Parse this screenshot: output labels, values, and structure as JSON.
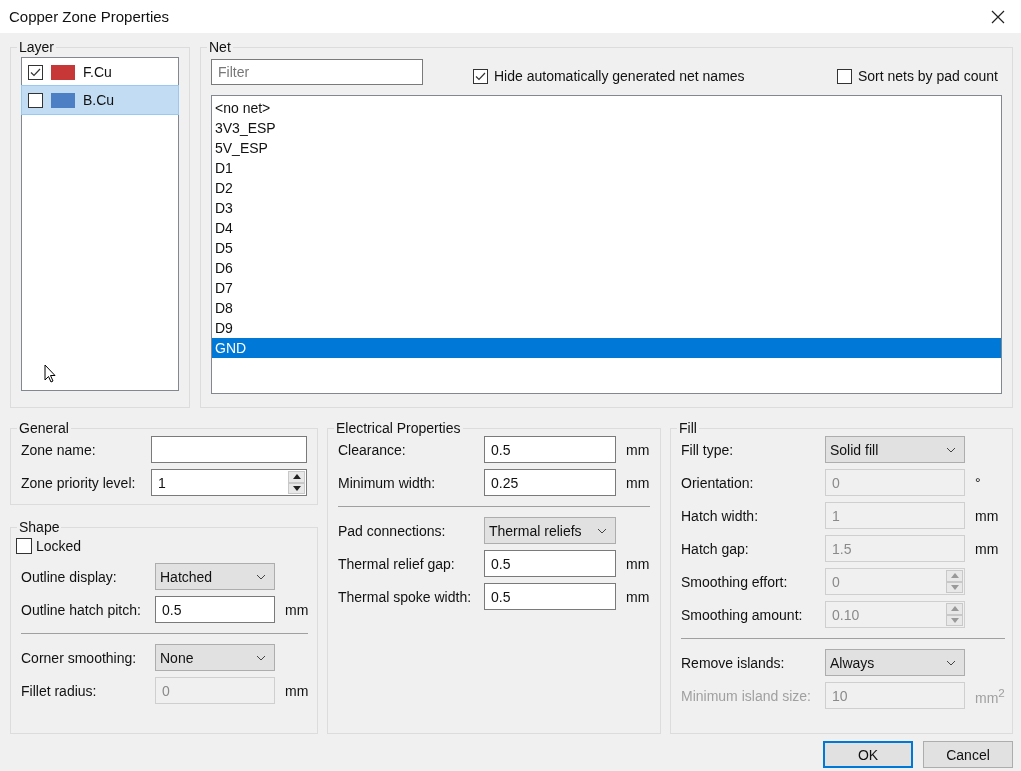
{
  "window": {
    "title": "Copper Zone Properties"
  },
  "layer": {
    "title": "Layer",
    "items": [
      {
        "name": "F.Cu",
        "color": "#c83737",
        "checked": true,
        "selected": false
      },
      {
        "name": "B.Cu",
        "color": "#4d7fc4",
        "checked": false,
        "selected": true
      }
    ]
  },
  "net": {
    "title": "Net",
    "filter": {
      "placeholder": "Filter"
    },
    "options": [
      {
        "label": "Hide automatically generated net names",
        "checked": true
      },
      {
        "label": "Sort nets by pad count",
        "checked": false
      }
    ],
    "items": [
      {
        "name": "<no net>",
        "selected": false
      },
      {
        "name": "3V3_ESP",
        "selected": false
      },
      {
        "name": "5V_ESP",
        "selected": false
      },
      {
        "name": "D1",
        "selected": false
      },
      {
        "name": "D2",
        "selected": false
      },
      {
        "name": "D3",
        "selected": false
      },
      {
        "name": "D4",
        "selected": false
      },
      {
        "name": "D5",
        "selected": false
      },
      {
        "name": "D6",
        "selected": false
      },
      {
        "name": "D7",
        "selected": false
      },
      {
        "name": "D8",
        "selected": false
      },
      {
        "name": "D9",
        "selected": false
      },
      {
        "name": "GND",
        "selected": true
      }
    ]
  },
  "columns": [
    [
      {
        "title": "General",
        "rows": [
          {
            "kind": "text",
            "label": "Zone name:",
            "disabled": false
          },
          {
            "kind": "spin",
            "label": "Zone priority level:",
            "value": "1",
            "disabled": false
          }
        ]
      },
      {
        "title": "Shape",
        "rows": [
          {
            "kind": "checkbox",
            "label": "Locked",
            "checked": false
          },
          {
            "kind": "select",
            "label": "Outline display:",
            "value": "Hatched",
            "disabled": false
          },
          {
            "kind": "text",
            "label": "Outline hatch pitch:",
            "value": "0.5",
            "unit": "mm",
            "disabled": false
          },
          {
            "kind": "separator"
          },
          {
            "kind": "select",
            "label": "Corner smoothing:",
            "value": "None",
            "disabled": false
          },
          {
            "kind": "text",
            "label": "Fillet radius:",
            "value": "0",
            "unit": "mm",
            "disabled": true
          }
        ]
      }
    ],
    [
      {
        "title": "Electrical Properties",
        "rows": [
          {
            "kind": "text",
            "label": "Clearance:",
            "value": "0.5",
            "unit": "mm",
            "disabled": false
          },
          {
            "kind": "text",
            "label": "Minimum width:",
            "value": "0.25",
            "unit": "mm",
            "disabled": false
          },
          {
            "kind": "separator"
          },
          {
            "kind": "select",
            "label": "Pad connections:",
            "value": "Thermal reliefs",
            "disabled": false
          },
          {
            "kind": "text",
            "label": "Thermal relief gap:",
            "value": "0.5",
            "unit": "mm",
            "disabled": false
          },
          {
            "kind": "text",
            "label": "Thermal spoke width:",
            "value": "0.5",
            "unit": "mm",
            "disabled": false
          }
        ]
      }
    ],
    [
      {
        "title": "Fill",
        "rows": [
          {
            "kind": "select",
            "label": "Fill type:",
            "value": "Solid fill",
            "disabled": false,
            "label_disabled": false
          },
          {
            "kind": "text",
            "label": "Orientation:",
            "value": "0",
            "unit": "°",
            "disabled": true,
            "label_disabled": false
          },
          {
            "kind": "text",
            "label": "Hatch width:",
            "value": "1",
            "unit": "mm",
            "disabled": true,
            "label_disabled": false
          },
          {
            "kind": "text",
            "label": "Hatch gap:",
            "value": "1.5",
            "unit": "mm",
            "disabled": true,
            "label_disabled": false
          },
          {
            "kind": "spin",
            "label": "Smoothing effort:",
            "value": "0",
            "disabled": true,
            "label_disabled": false
          },
          {
            "kind": "spin",
            "label": "Smoothing amount:",
            "value": "0.10",
            "disabled": true,
            "label_disabled": false
          },
          {
            "kind": "separator"
          },
          {
            "kind": "select",
            "label": "Remove islands:",
            "value": "Always",
            "disabled": false,
            "label_disabled": false
          },
          {
            "kind": "text",
            "label": "Minimum island size:",
            "value": "10",
            "unit": "mm$^{2}$",
            "disabled": true,
            "label_disabled": true
          }
        ]
      }
    ]
  ],
  "buttons": [
    {
      "label": "OK",
      "default": true
    },
    {
      "label": "Cancel",
      "default": false
    }
  ]
}
